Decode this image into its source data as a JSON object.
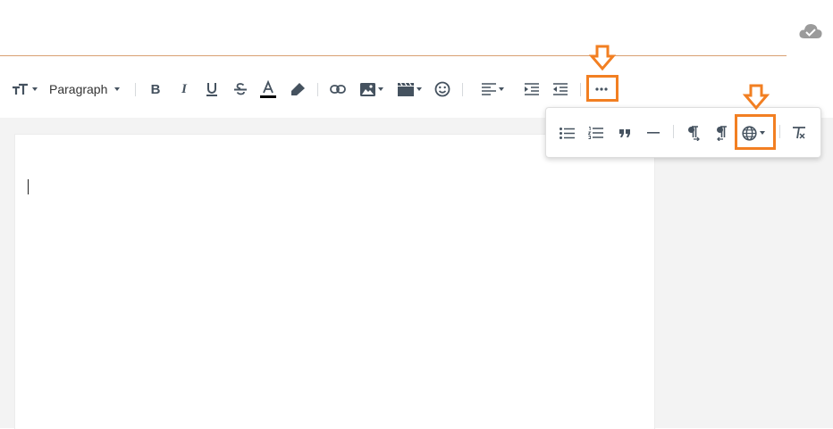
{
  "toolbar": {
    "font_size_icon": "font-size-icon",
    "paragraph_label": "Paragraph",
    "bold_icon": "bold-icon",
    "italic_icon": "italic-icon",
    "underline_icon": "underline-icon",
    "strikethrough_icon": "strikethrough-icon",
    "text_color_icon": "text-color-icon",
    "highlight_icon": "highlighter-icon",
    "link_icon": "link-icon",
    "image_icon": "image-icon",
    "video_icon": "video-icon",
    "emoji_icon": "emoji-icon",
    "align_icon": "align-left-icon",
    "indent_icon": "indent-icon",
    "outdent_icon": "outdent-icon",
    "more_icon": "more-dots-icon"
  },
  "more_popup": {
    "items": [
      "bulleted-list-icon",
      "numbered-list-icon",
      "quote-icon",
      "horizontal-line-icon",
      "ltr-icon",
      "rtl-icon",
      "language-globe-icon",
      "clear-format-icon"
    ]
  },
  "colors": {
    "accent_orange": "#f27f22",
    "icon_gray": "#45525f",
    "editor_bg": "#f3f3f3",
    "title_underline": "#d9a071"
  }
}
